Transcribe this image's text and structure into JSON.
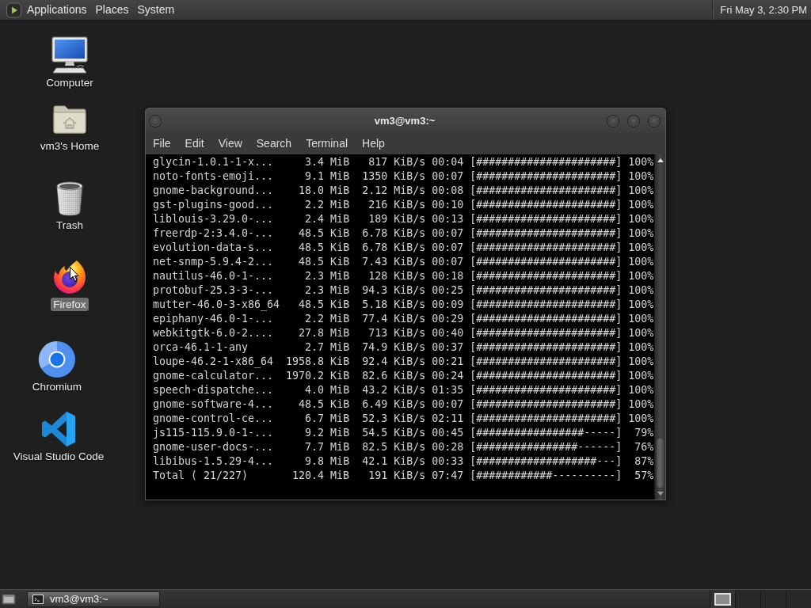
{
  "top_panel": {
    "menus": [
      "Applications",
      "Places",
      "System"
    ],
    "clock": "Fri May 3, 2:30 PM"
  },
  "desktop_icons": [
    {
      "kind": "computer",
      "label": "Computer",
      "selected": false
    },
    {
      "kind": "home",
      "label": "vm3's Home",
      "selected": false
    },
    {
      "kind": "trash",
      "label": "Trash",
      "selected": false
    },
    {
      "kind": "firefox",
      "label": "Firefox",
      "selected": true
    },
    {
      "kind": "chromium",
      "label": "Chromium",
      "selected": false
    },
    {
      "kind": "vscode",
      "label": "Visual Studio Code",
      "selected": false
    }
  ],
  "terminal": {
    "title": "vm3@vm3:~",
    "menu": [
      "File",
      "Edit",
      "View",
      "Search",
      "Terminal",
      "Help"
    ],
    "rows": [
      {
        "name": "glycin-1.0.1-1-x...",
        "size": "3.4 MiB",
        "rate": "817 KiB/s",
        "eta": "00:04",
        "bar": "[######################]",
        "percent": "100%"
      },
      {
        "name": "noto-fonts-emoji...",
        "size": "9.1 MiB",
        "rate": "1350 KiB/s",
        "eta": "00:07",
        "bar": "[######################]",
        "percent": "100%"
      },
      {
        "name": "gnome-background...",
        "size": "18.0 MiB",
        "rate": "2.12 MiB/s",
        "eta": "00:08",
        "bar": "[######################]",
        "percent": "100%"
      },
      {
        "name": "gst-plugins-good...",
        "size": "2.2 MiB",
        "rate": "216 KiB/s",
        "eta": "00:10",
        "bar": "[######################]",
        "percent": "100%"
      },
      {
        "name": "liblouis-3.29.0-...",
        "size": "2.4 MiB",
        "rate": "189 KiB/s",
        "eta": "00:13",
        "bar": "[######################]",
        "percent": "100%"
      },
      {
        "name": "freerdp-2:3.4.0-...",
        "size": "48.5 KiB",
        "rate": "6.78 KiB/s",
        "eta": "00:07",
        "bar": "[######################]",
        "percent": "100%"
      },
      {
        "name": "evolution-data-s...",
        "size": "48.5 KiB",
        "rate": "6.78 KiB/s",
        "eta": "00:07",
        "bar": "[######################]",
        "percent": "100%"
      },
      {
        "name": "net-snmp-5.9.4-2...",
        "size": "48.5 KiB",
        "rate": "7.43 KiB/s",
        "eta": "00:07",
        "bar": "[######################]",
        "percent": "100%"
      },
      {
        "name": "nautilus-46.0-1-...",
        "size": "2.3 MiB",
        "rate": "128 KiB/s",
        "eta": "00:18",
        "bar": "[######################]",
        "percent": "100%"
      },
      {
        "name": "protobuf-25.3-3-...",
        "size": "2.3 MiB",
        "rate": "94.3 KiB/s",
        "eta": "00:25",
        "bar": "[######################]",
        "percent": "100%"
      },
      {
        "name": "mutter-46.0-3-x86_64",
        "size": "48.5 KiB",
        "rate": "5.18 KiB/s",
        "eta": "00:09",
        "bar": "[######################]",
        "percent": "100%"
      },
      {
        "name": "epiphany-46.0-1-...",
        "size": "2.2 MiB",
        "rate": "77.4 KiB/s",
        "eta": "00:29",
        "bar": "[######################]",
        "percent": "100%"
      },
      {
        "name": "webkitgtk-6.0-2....",
        "size": "27.8 MiB",
        "rate": "713 KiB/s",
        "eta": "00:40",
        "bar": "[######################]",
        "percent": "100%"
      },
      {
        "name": "orca-46.1-1-any",
        "size": "2.7 MiB",
        "rate": "74.9 KiB/s",
        "eta": "00:37",
        "bar": "[######################]",
        "percent": "100%"
      },
      {
        "name": "loupe-46.2-1-x86_64",
        "size": "1958.8 KiB",
        "rate": "92.4 KiB/s",
        "eta": "00:21",
        "bar": "[######################]",
        "percent": "100%"
      },
      {
        "name": "gnome-calculator...",
        "size": "1970.2 KiB",
        "rate": "82.6 KiB/s",
        "eta": "00:24",
        "bar": "[######################]",
        "percent": "100%"
      },
      {
        "name": "speech-dispatche...",
        "size": "4.0 MiB",
        "rate": "43.2 KiB/s",
        "eta": "01:35",
        "bar": "[######################]",
        "percent": "100%"
      },
      {
        "name": "gnome-software-4...",
        "size": "48.5 KiB",
        "rate": "6.49 KiB/s",
        "eta": "00:07",
        "bar": "[######################]",
        "percent": "100%"
      },
      {
        "name": "gnome-control-ce...",
        "size": "6.7 MiB",
        "rate": "52.3 KiB/s",
        "eta": "02:11",
        "bar": "[######################]",
        "percent": "100%"
      },
      {
        "name": "js115-115.9.0-1-...",
        "size": "9.2 MiB",
        "rate": "54.5 KiB/s",
        "eta": "00:45",
        "bar": "[#################-----]",
        "percent": "79%"
      },
      {
        "name": "gnome-user-docs-...",
        "size": "7.7 MiB",
        "rate": "82.5 KiB/s",
        "eta": "00:28",
        "bar": "[################------]",
        "percent": "76%"
      },
      {
        "name": "libibus-1.5.29-4...",
        "size": "9.8 MiB",
        "rate": "42.1 KiB/s",
        "eta": "00:33",
        "bar": "[###################---]",
        "percent": "87%"
      },
      {
        "name": "Total ( 21/227)",
        "size": "120.4 MiB",
        "rate": "191 KiB/s",
        "eta": "07:47",
        "bar": "[############----------]",
        "percent": "57%"
      }
    ]
  },
  "bottom_panel": {
    "windows": [
      {
        "title": "vm3@vm3:~",
        "selected": true
      }
    ],
    "workspaces": [
      {
        "selected": true
      },
      {
        "selected": false
      },
      {
        "selected": false
      },
      {
        "selected": false
      }
    ]
  }
}
